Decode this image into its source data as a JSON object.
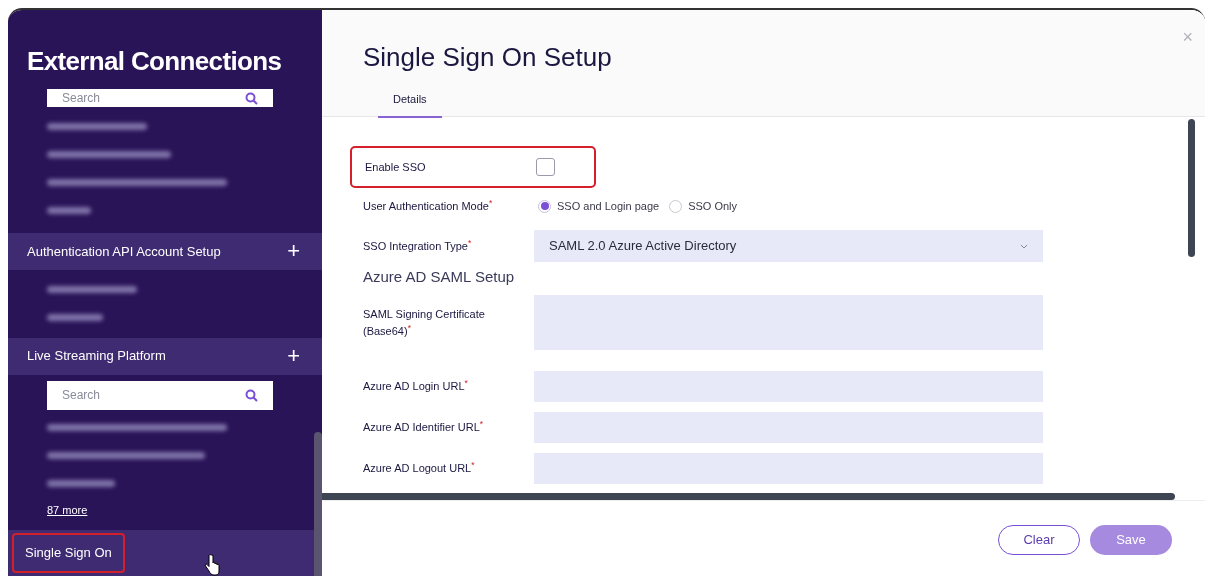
{
  "sidebar": {
    "title": "External Connections",
    "sections": [
      {
        "kind": "list",
        "search": {
          "placeholder": "Search"
        },
        "items": [
          {
            "kind": "redacted"
          },
          {
            "kind": "redacted"
          },
          {
            "kind": "redacted"
          },
          {
            "kind": "redacted"
          }
        ]
      },
      {
        "kind": "group",
        "label": "Authentication API Account Setup",
        "expand_icon": "+",
        "items": [
          {
            "kind": "redacted"
          },
          {
            "kind": "redacted"
          }
        ]
      },
      {
        "kind": "group",
        "label": "Live Streaming Platform",
        "expand_icon": "+",
        "search": {
          "placeholder": "Search"
        },
        "items": [
          {
            "kind": "redacted"
          },
          {
            "kind": "redacted"
          },
          {
            "kind": "redacted"
          }
        ],
        "more_link": "87 more"
      },
      {
        "kind": "nav",
        "label": "Single Sign On",
        "selected": true,
        "highlighted": true
      }
    ]
  },
  "dialog": {
    "title": "Single Sign On Setup",
    "close": "×",
    "tabs": [
      {
        "label": "Details",
        "selected": true
      }
    ],
    "fields": [
      {
        "kind": "checkbox",
        "label": "Enable SSO",
        "checked": false,
        "highlighted": true
      },
      {
        "kind": "radio",
        "label": "User Authentication Mode$^{*}$",
        "options": [
          {
            "label": "SSO and Login page",
            "selected": true
          },
          {
            "label": "SSO Only",
            "selected": false
          }
        ]
      },
      {
        "kind": "select",
        "label": "SSO Integration Type$^{*}$",
        "value": "SAML 2.0 Azure Active Directory"
      },
      {
        "kind": "heading",
        "label": "Azure AD SAML Setup"
      },
      {
        "kind": "textarea",
        "label": "SAML Signing Certificate (Base64)$^{*}$"
      },
      {
        "kind": "text",
        "label": "Azure AD Login URL$^{*}$"
      },
      {
        "kind": "text",
        "label": "Azure AD Identifier URL$^{*}$"
      },
      {
        "kind": "text",
        "label": "Azure AD Logout URL$^{*}$"
      }
    ],
    "buttons": [
      {
        "label": "Clear",
        "disabled": false,
        "kind": "outline"
      },
      {
        "label": "Save",
        "disabled": true,
        "kind": "primary"
      }
    ]
  }
}
